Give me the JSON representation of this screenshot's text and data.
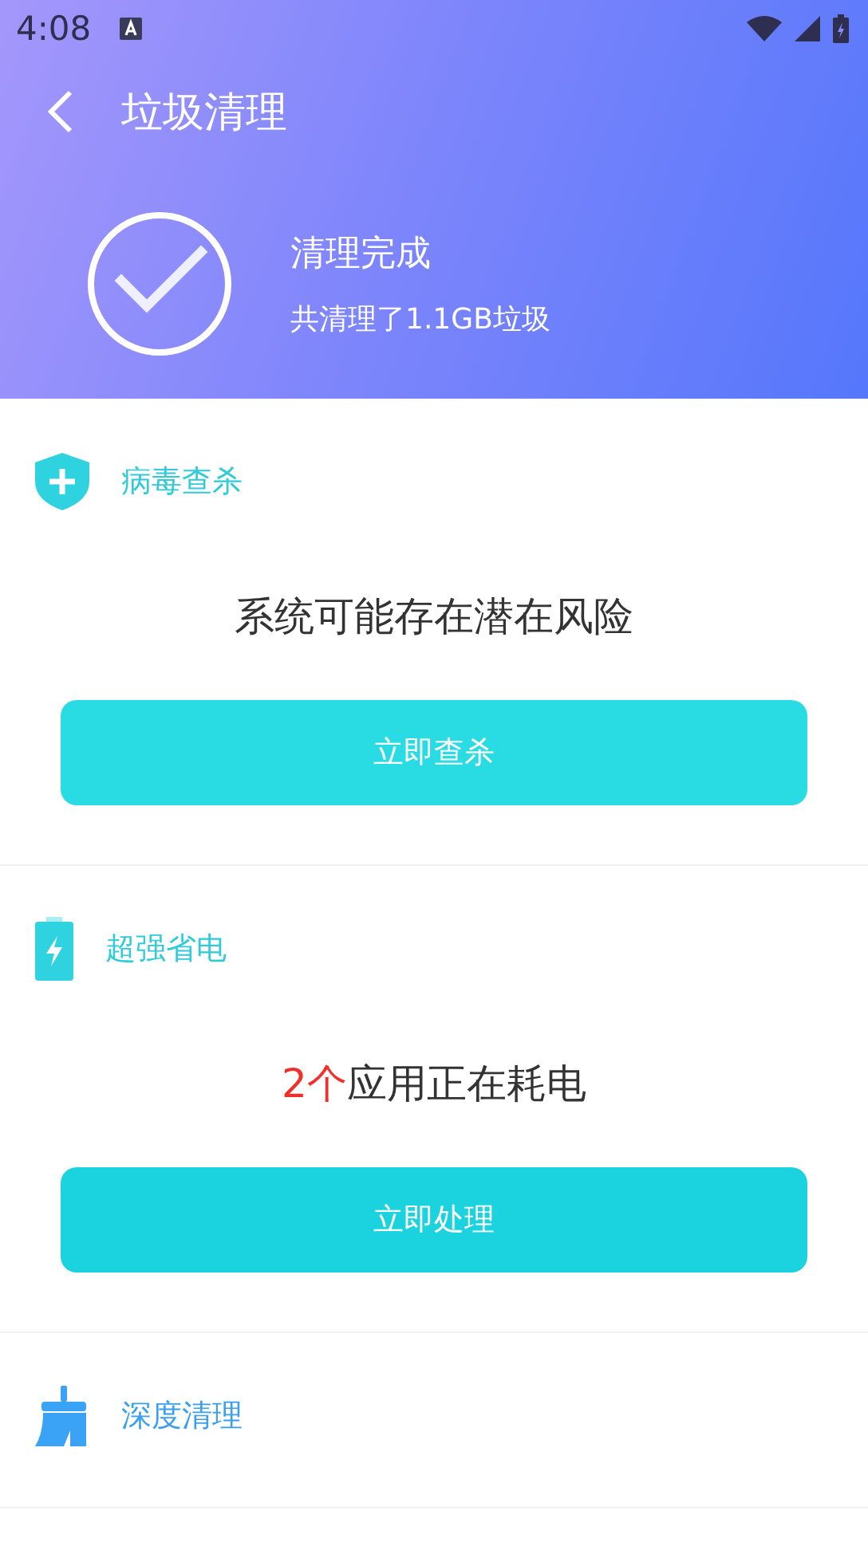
{
  "status_bar": {
    "time": "4:08"
  },
  "header": {
    "title": "垃圾清理",
    "status": "清理完成",
    "summary": "共清理了1.1GB垃圾"
  },
  "sections": [
    {
      "kind": "shield",
      "title": "病毒查杀",
      "message": [
        {
          "text": "系统可能存在潜在风险",
          "accent": false
        }
      ],
      "button": "立即查杀"
    },
    {
      "kind": "battery",
      "title": "超强省电",
      "message": [
        {
          "text": "2个",
          "accent": true
        },
        {
          "text": "应用正在耗电",
          "accent": false
        }
      ],
      "button": "立即处理"
    },
    {
      "kind": "broom",
      "title": "深度清理"
    }
  ]
}
